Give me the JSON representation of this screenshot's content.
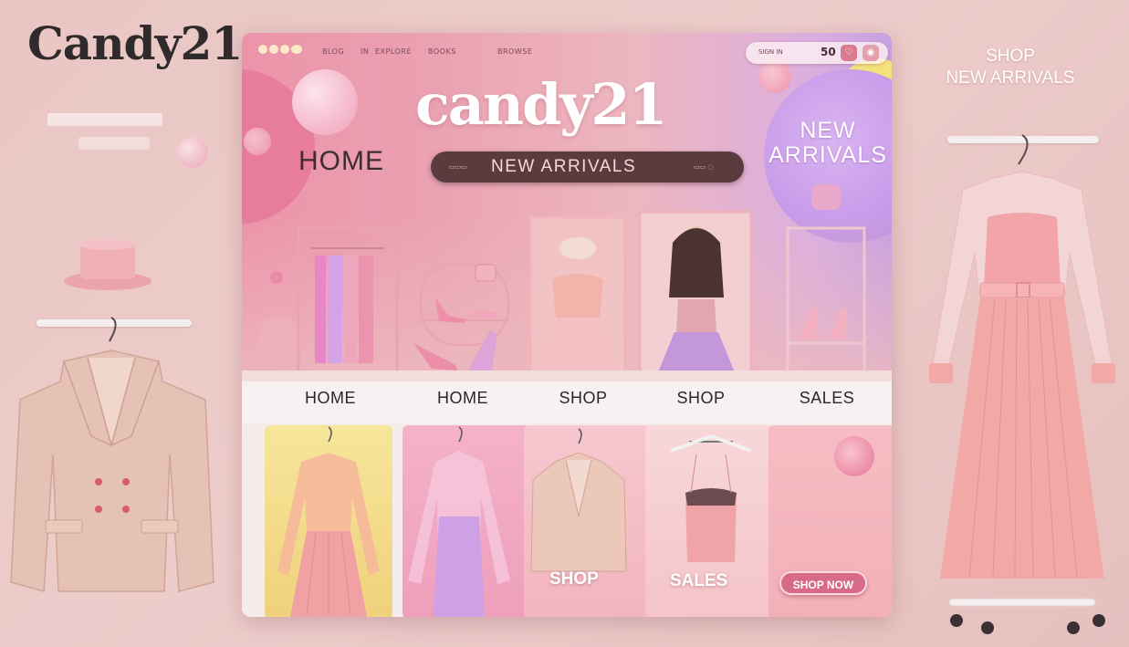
{
  "brand": {
    "logo": "Candy21"
  },
  "side_right": {
    "title_line1": "SHOP",
    "title_line2": "NEW ARRIVALS"
  },
  "window": {
    "topbar": {
      "nav_items": [
        "BLOG",
        "IN",
        "EXPLORE",
        "BOOKS",
        "BROWSE"
      ],
      "account_label": "SIGN IN",
      "cart_count": "50"
    },
    "hero": {
      "logo": "candy21",
      "home_label": "HOME",
      "search_label": "NEW ARRIVALS",
      "badge_line1": "NEW",
      "badge_line2": "ARRIVALS"
    },
    "nav": {
      "items": [
        "HOME",
        "HOME",
        "SHOP",
        "SHOP",
        "SALES"
      ]
    },
    "cards": [
      {
        "label": ""
      },
      {
        "label": ""
      },
      {
        "label": "SHOP"
      },
      {
        "label": "SALES"
      },
      {
        "label": "",
        "button": "SHOP NOW"
      }
    ]
  },
  "colors": {
    "background": "#e9c6c3",
    "hero_pink": "#ec93aa",
    "lavender": "#c79ae8",
    "yellow": "#f4e27c",
    "button": "#d76b87"
  }
}
